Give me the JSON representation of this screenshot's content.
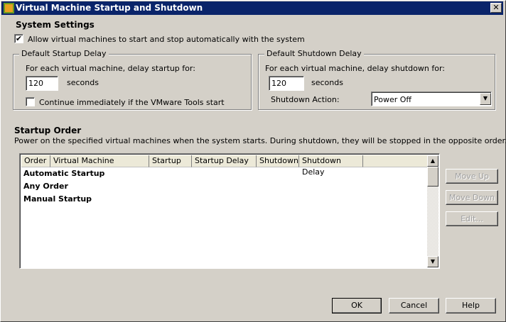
{
  "window": {
    "title": "Virtual Machine Startup and Shutdown",
    "close": "✕"
  },
  "system": {
    "heading": "System Settings",
    "allow_label": "Allow virtual machines to start and stop automatically with the system",
    "allow_checked": true
  },
  "startup": {
    "legend": "Default Startup Delay",
    "prompt": "For each virtual machine, delay startup for:",
    "value": "120",
    "unit": "seconds",
    "continue_label": "Continue immediately if the VMware Tools start",
    "continue_checked": false
  },
  "shutdown": {
    "legend": "Default Shutdown Delay",
    "prompt": "For each virtual machine, delay shutdown for:",
    "value": "120",
    "unit": "seconds",
    "action_label": "Shutdown Action:",
    "action_value": "Power Off"
  },
  "order": {
    "heading": "Startup Order",
    "description": "Power on the specified virtual machines when the system starts. During shutdown, they will be stopped in the opposite order.",
    "columns": [
      "Order",
      "Virtual Machine",
      "Startup",
      "Startup Delay",
      "Shutdown",
      "Shutdown Delay"
    ],
    "rows": [
      "Automatic Startup",
      "Any Order",
      "Manual Startup"
    ]
  },
  "side_buttons": {
    "move_up": "Move Up",
    "move_down": "Move Down",
    "edit": "Edit..."
  },
  "footer": {
    "ok": "OK",
    "cancel": "Cancel",
    "help": "Help"
  }
}
